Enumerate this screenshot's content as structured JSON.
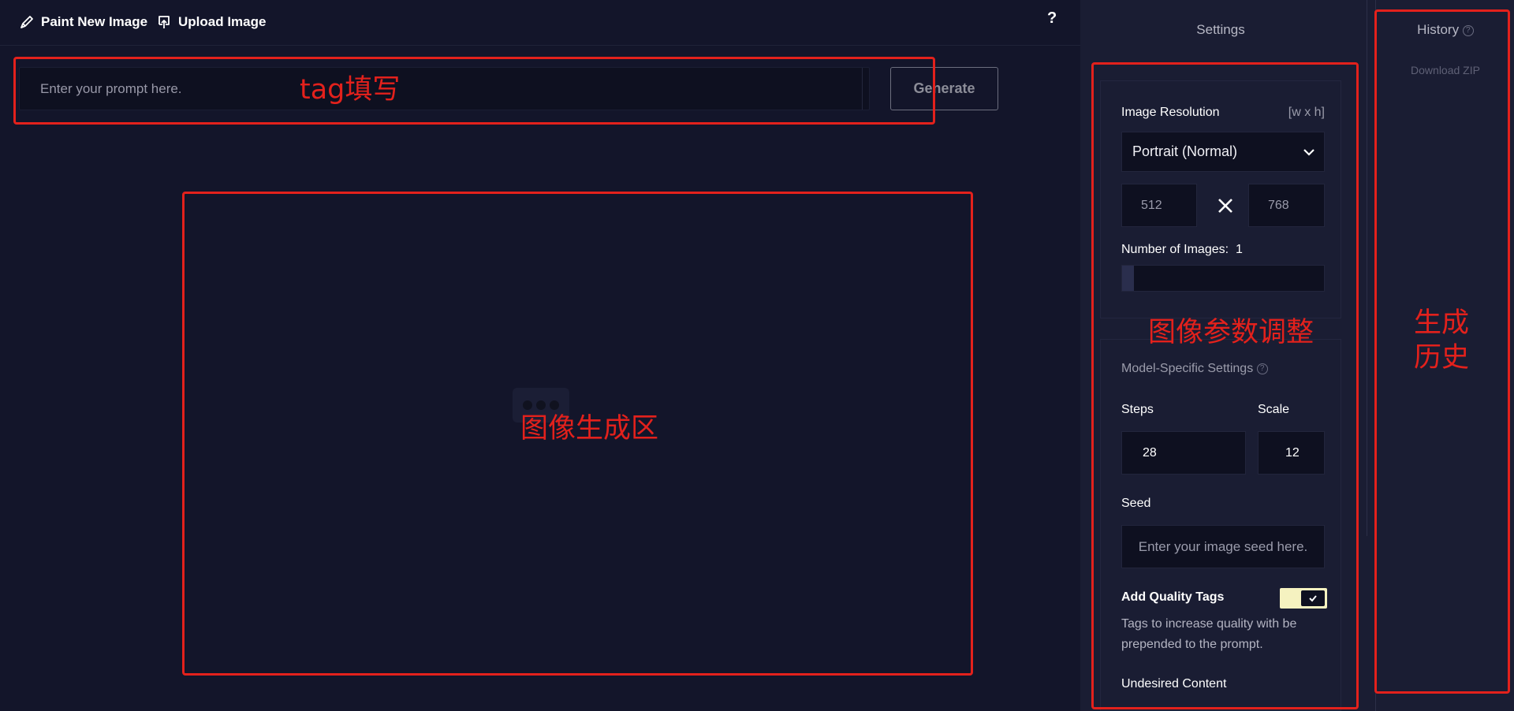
{
  "topbar": {
    "paint_label": "Paint New Image",
    "upload_label": "Upload Image",
    "help_label": "?"
  },
  "prompt": {
    "placeholder": "Enter your prompt here.",
    "generate_label": "Generate"
  },
  "settings": {
    "title": "Settings",
    "resolution": {
      "label": "Image Resolution",
      "hint": "[w x h]",
      "selected": "Portrait (Normal)",
      "width": "512",
      "height": "768"
    },
    "number_of_images": {
      "label": "Number of Images:",
      "value": "1",
      "fill_fraction": 0.06
    },
    "model_specific": {
      "label": "Model-Specific Settings",
      "steps_label": "Steps",
      "steps_value": "28",
      "scale_label": "Scale",
      "scale_value": "12",
      "seed_label": "Seed",
      "seed_placeholder": "Enter your image seed here.",
      "quality_tags_label": "Add Quality Tags",
      "quality_tags_enabled": true,
      "quality_tags_desc": "Tags to increase quality with be prepended to the prompt.",
      "undesired_label": "Undesired Content"
    }
  },
  "history": {
    "title": "History",
    "download_label": "Download ZIP"
  },
  "annotations": {
    "prompt_note": "tag填写",
    "image_note": "图像生成区",
    "params_note": "图像参数调整",
    "history_note": "生成\n历史"
  },
  "colors": {
    "background": "#13152a",
    "panel": "#1a1d33",
    "input": "#0e1020",
    "toggle_on": "#f5f2c0",
    "annotation": "#e3211c"
  }
}
